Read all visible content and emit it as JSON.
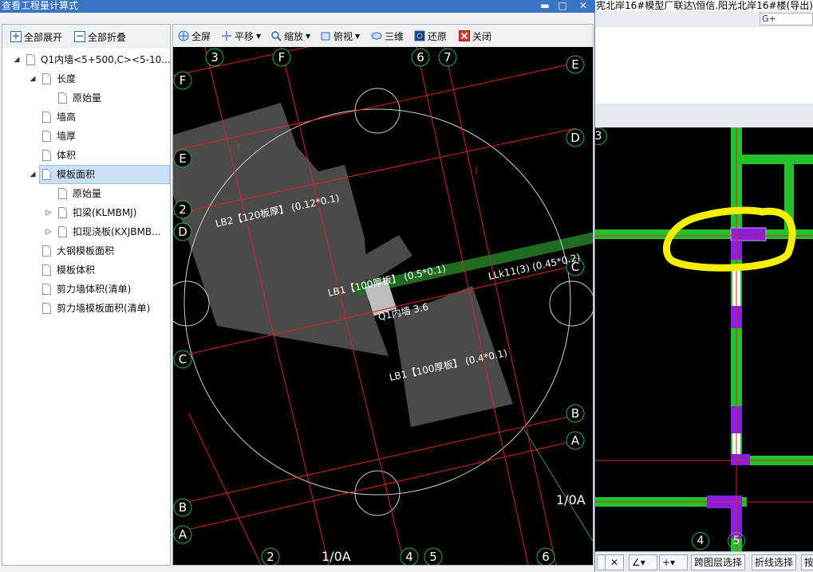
{
  "background_app": {
    "title_fragment": "宪北岸16#模型厂联达\\恒信.阳光北岸16#楼(导出).G",
    "combo_value": "G+",
    "axis_labels": {
      "three": "3",
      "four": "4",
      "five": "5"
    },
    "status_buttons": {
      "layer_select": "跨图层选择",
      "polyline_select": "折线选择",
      "cut": "按"
    }
  },
  "dialog": {
    "title": "查看工程量计算式",
    "window_buttons": {
      "minimize": "▬",
      "maximize": "□",
      "close": "✕"
    }
  },
  "tree_toolbar": {
    "expand_all": "全部展开",
    "collapse_all": "全部折叠"
  },
  "tree": [
    {
      "label": "Q1内墙<5+500,C><5-10...",
      "level": 0,
      "expander": "◢",
      "selected": false
    },
    {
      "label": "长度",
      "level": 1,
      "expander": "◢",
      "selected": false
    },
    {
      "label": "原始量",
      "level": 2,
      "expander": "",
      "selected": false
    },
    {
      "label": "墙高",
      "level": 1,
      "expander": "",
      "selected": false
    },
    {
      "label": "墙厚",
      "level": 1,
      "expander": "",
      "selected": false
    },
    {
      "label": "体积",
      "level": 1,
      "expander": "",
      "selected": false
    },
    {
      "label": "模板面积",
      "level": 1,
      "expander": "◢",
      "selected": true
    },
    {
      "label": "原始量",
      "level": 2,
      "expander": "",
      "selected": false
    },
    {
      "label": "扣梁(KLMBMJ)",
      "level": 2,
      "expander": "▷",
      "selected": false
    },
    {
      "label": "扣现浇板(KXJBMB...",
      "level": 2,
      "expander": "▷",
      "selected": false
    },
    {
      "label": "大钢模板面积",
      "level": 1,
      "expander": "",
      "selected": false
    },
    {
      "label": "模板体积",
      "level": 1,
      "expander": "",
      "selected": false
    },
    {
      "label": "剪力墙体积(清单)",
      "level": 1,
      "expander": "",
      "selected": false
    },
    {
      "label": "剪力墙模板面积(清单)",
      "level": 1,
      "expander": "",
      "selected": false
    }
  ],
  "view_toolbar": {
    "fullscreen": "全屏",
    "pan": "平移",
    "zoom": "缩放",
    "view": "俯视",
    "three_d": "三维",
    "restore": "还原",
    "close": "关闭"
  },
  "drawing": {
    "axis_labels": {
      "c3": "3",
      "cF_top": "F",
      "c6": "6",
      "c7": "7",
      "cE_right": "E",
      "cF_left": "F",
      "cE_left": "E",
      "cD_right": "D",
      "c2_left": "2",
      "cD_left": "D",
      "cC_right": "C",
      "cC_left": "C",
      "cB_right": "B",
      "cA_right": "A",
      "cB_left": "B",
      "cA_left": "A",
      "c2_bottom": "2",
      "c4_bottom": "4",
      "c5_bottom": "5",
      "c6_bottom": "6"
    },
    "axis_text": {
      "slash_0A_bottom": "1/0A",
      "slash_0A_right": "1/0A"
    },
    "labels": {
      "lb2": "LB2【120板厚】 (0.12*0.1)",
      "lb1_top": "LB1【100厚板】 (0.5*0.1)",
      "llk11": "LLk11(3) (0.45*0.2)",
      "q1": "Q1内墙 3.6",
      "lb1_bottom": "LB1【100厚板】 (0.4*0.1)"
    }
  }
}
